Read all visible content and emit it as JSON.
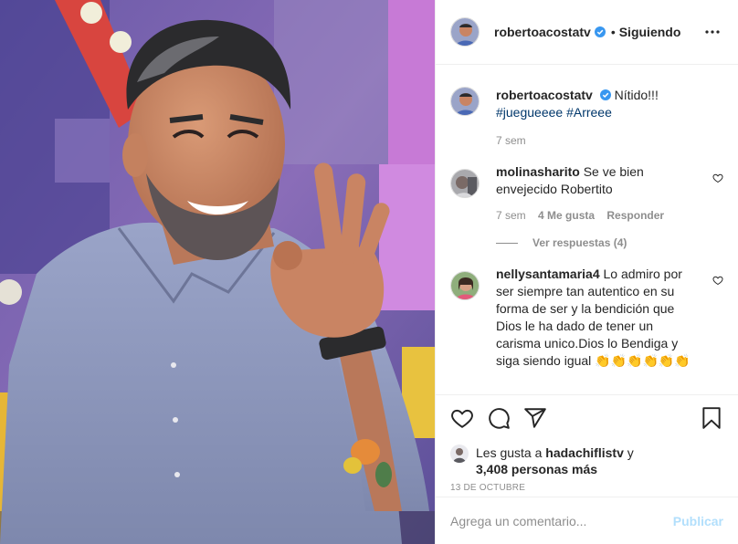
{
  "post": {
    "author": "robertoacostatv",
    "follow_status": "Siguiendo",
    "separator": "•"
  },
  "caption": {
    "author": "robertoacostatv",
    "text": "Nítido!!!",
    "hashtags": "#juegueeee #Arreee",
    "age": "7 sem"
  },
  "comments": [
    {
      "author": "molinasharito",
      "text": "Se ve bien envejecido Robertito",
      "age": "7 sem",
      "likes": "4 Me gusta",
      "reply": "Responder",
      "view_replies": "Ver respuestas (4)"
    },
    {
      "author": "nellysantamaria4",
      "text": "Lo admiro por ser siempre tan autentico en su forma de ser y la bendición que Dios le ha dado de tener un carisma unico.Dios lo Bendiga y siga siendo igual 👏👏👏👏👏👏"
    }
  ],
  "likes": {
    "prefix": "Les gusta a",
    "user": "hadachiflistv",
    "connector": "y",
    "count": "3,408 personas más"
  },
  "date": "13 DE OCTUBRE",
  "composer": {
    "placeholder": "Agrega un comentario...",
    "publish_label": "Publicar"
  },
  "colors": {
    "verified_blue": "#3897f0",
    "link_blue": "#00376b",
    "muted_gray": "#8e8e8e",
    "publish_disabled": "#b2dffc"
  },
  "icons": [
    "verified-icon",
    "more-options-icon",
    "heart-icon",
    "comment-icon",
    "share-icon",
    "bookmark-icon"
  ]
}
